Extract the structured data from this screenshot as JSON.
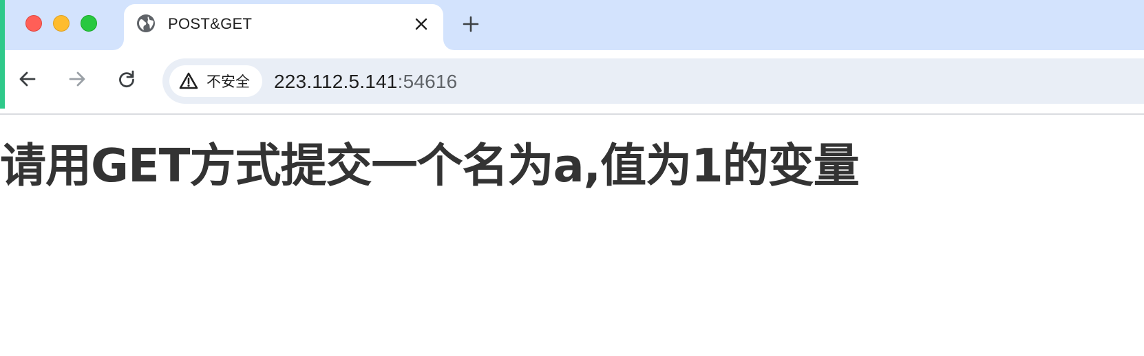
{
  "tab": {
    "title": "POST&GET",
    "favicon": "globe-icon",
    "close_icon": "close-icon"
  },
  "new_tab_icon": "plus-icon",
  "toolbar": {
    "back_icon": "arrow-left-icon",
    "forward_icon": "arrow-right-icon",
    "reload_icon": "reload-icon"
  },
  "omnibox": {
    "security_icon": "warning-triangle-icon",
    "security_label": "不安全",
    "url_host": "223.112.5.141",
    "url_port": ":54616"
  },
  "page": {
    "heading": "请用GET方式提交一个名为a,值为1的变量"
  },
  "colors": {
    "tab_strip": "#d3e3fd",
    "omnibox": "#e9eef6",
    "heading_text": "#333333",
    "traffic_red": "#ff5f57",
    "traffic_yellow": "#febc2e",
    "traffic_green": "#28c840"
  }
}
